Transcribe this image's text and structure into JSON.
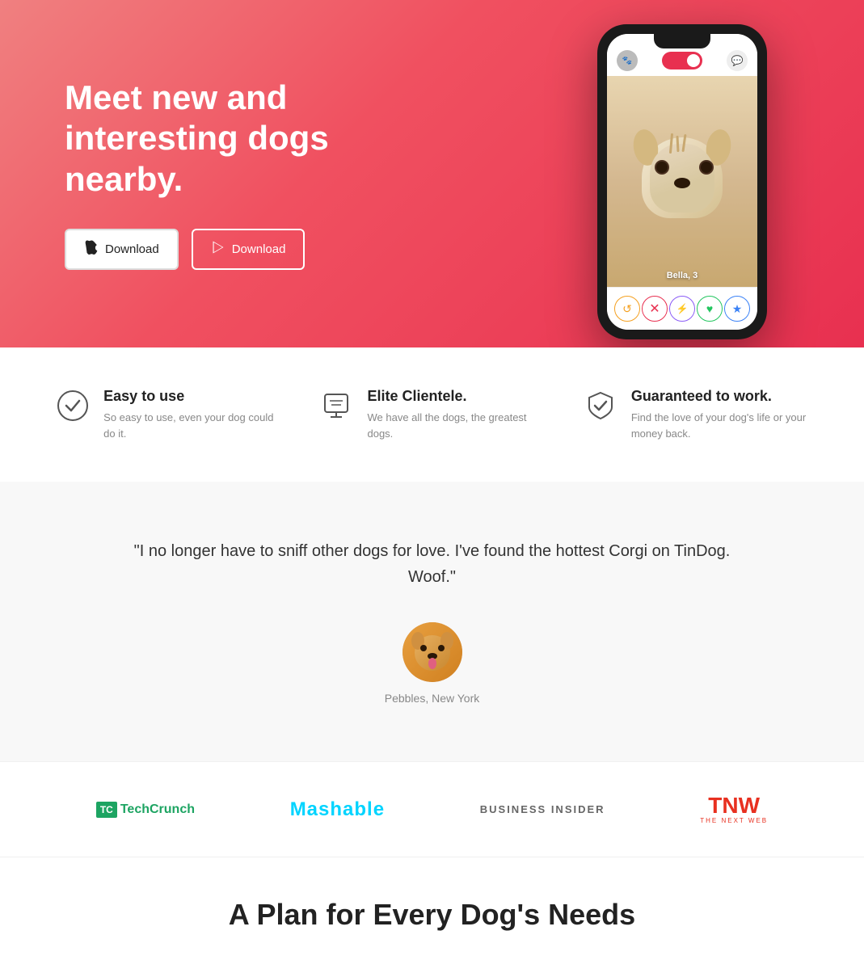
{
  "hero": {
    "title": "Meet new and interesting dogs nearby.",
    "btn_apple_label": "Download",
    "btn_google_label": "Download"
  },
  "features": [
    {
      "icon": "✓",
      "title": "Easy to use",
      "desc": "So easy to use, even your dog could do it."
    },
    {
      "icon": "🎓",
      "title": "Elite Clientele.",
      "desc": "We have all the dogs, the greatest dogs."
    },
    {
      "icon": "🎯",
      "title": "Guaranteed to work.",
      "desc": "Find the love of your dog's life or your money back."
    }
  ],
  "testimonial": {
    "quote": "\"I no longer have to sniff other dogs for love. I've found the hottest Corgi on TinDog. Woof.\"",
    "person": "Pebbles, New York"
  },
  "press": {
    "logos": [
      {
        "name": "TechCrunch",
        "type": "techcrunch"
      },
      {
        "name": "Mashable",
        "type": "mashable"
      },
      {
        "name": "Business Insider",
        "type": "business-insider"
      },
      {
        "name": "TNW",
        "type": "tnw"
      }
    ]
  },
  "pricing": {
    "title": "A Plan for Every Dog's Needs"
  },
  "phone": {
    "action_rewind": "↺",
    "action_nope": "✕",
    "action_boost": "⚡",
    "action_like": "♥",
    "action_star": "★"
  }
}
